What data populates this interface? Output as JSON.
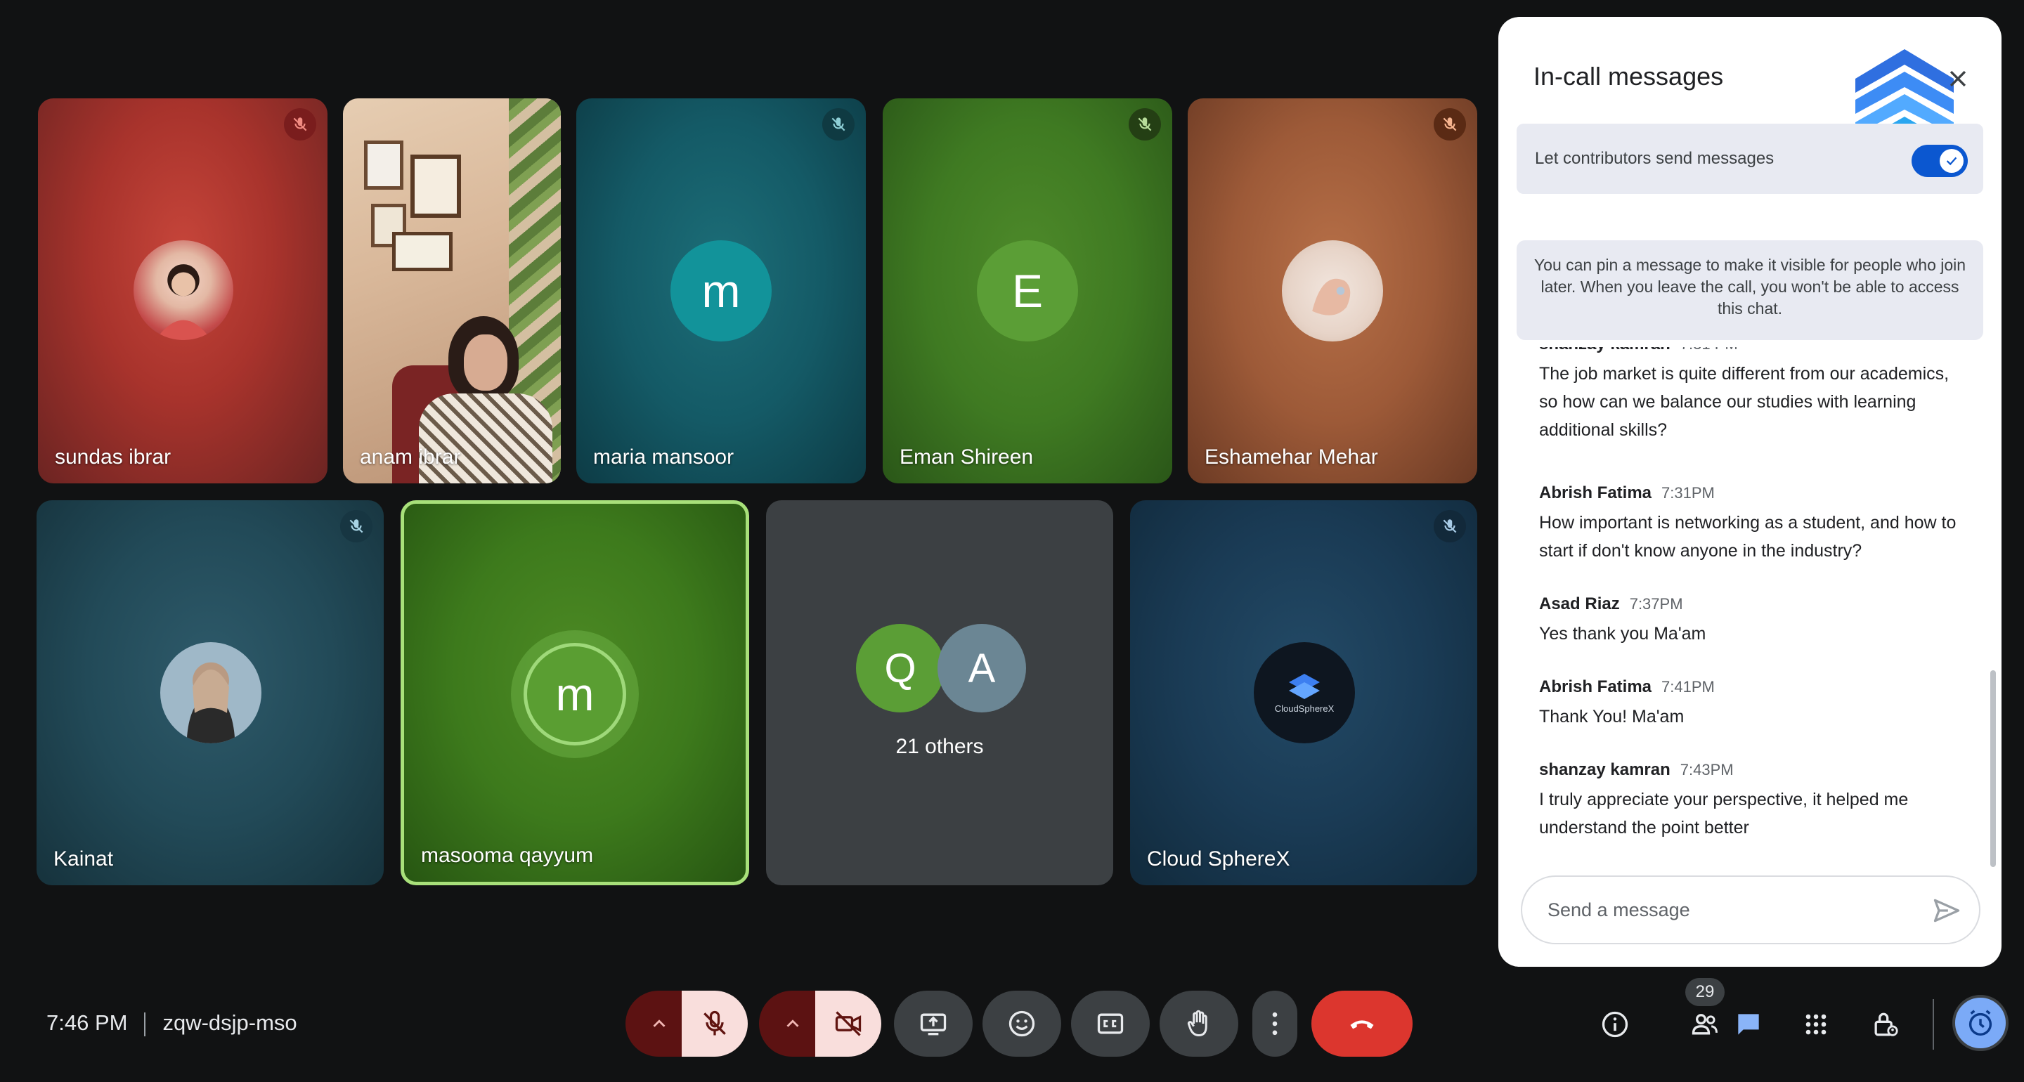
{
  "tiles": [
    {
      "name": "sundas ibrar",
      "muted": true
    },
    {
      "name": "anam ibrar",
      "muted": false
    },
    {
      "name": "maria mansoor",
      "muted": true,
      "initial": "m"
    },
    {
      "name": "Eman Shireen",
      "muted": true,
      "initial": "E"
    },
    {
      "name": "Eshamehar Mehar",
      "muted": true
    },
    {
      "name": "Kainat",
      "muted": true
    },
    {
      "name": "masooma qayyum",
      "muted": false,
      "initial": "m",
      "speaking": true
    },
    {
      "name": "21 others",
      "initials": [
        "Q",
        "A"
      ]
    },
    {
      "name": "Cloud SphereX",
      "muted": true,
      "logo_text": "CloudSphereX"
    }
  ],
  "chat": {
    "title": "In-call messages",
    "toggle_label": "Let contributors send messages",
    "toggle_on": true,
    "info": "You can pin a message to make it visible for people who join later. When you leave the call, you won't be able to access this chat.",
    "messages": [
      {
        "sender": "shanzay kamran",
        "time": "7:31 PM",
        "text": "The job market is quite different from our academics, so how can we balance our studies with learning additional skills?"
      },
      {
        "sender": "Abrish Fatima",
        "time": "7:31PM",
        "text": "How important is networking as a student, and how to start if don't know anyone in the industry?"
      },
      {
        "sender": "Asad Riaz",
        "time": "7:37PM",
        "text": "Yes thank you Ma'am"
      },
      {
        "sender": "Abrish Fatima",
        "time": "7:41PM",
        "text": "Thank You! Ma'am"
      },
      {
        "sender": "shanzay kamran",
        "time": "7:43PM",
        "text": "I truly appreciate your perspective, it helped me understand the point better"
      }
    ],
    "input_placeholder": "Send a message"
  },
  "meeting": {
    "time": "7:46 PM",
    "code": "zqw-dsjp-mso",
    "participant_count": "29"
  },
  "colors": {
    "end_call": "#dc362e",
    "mic_off_bg": "#f9dedc",
    "accent_blue": "#0b57d0",
    "speaking_border": "#a8e07a"
  }
}
